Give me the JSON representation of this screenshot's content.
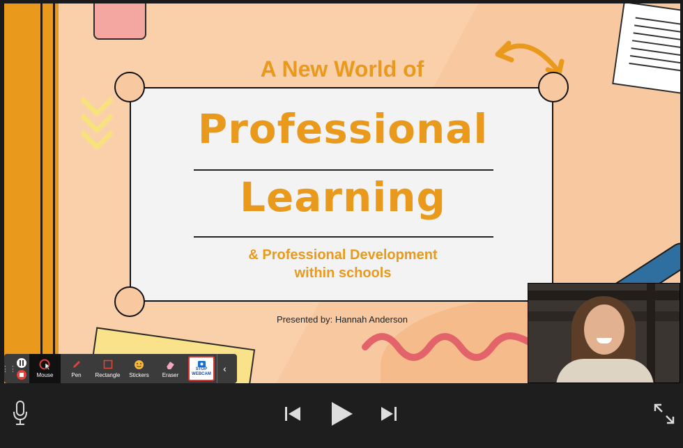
{
  "slide": {
    "kicker": "A New World of",
    "title_line1": "Professional",
    "title_line2": "Learning",
    "subtitle_line1": "& Professional Development",
    "subtitle_line2": "within schools",
    "presenter": "Presented by: Hannah Anderson"
  },
  "toolbar": {
    "tools": [
      {
        "label": "Mouse",
        "icon": "mouse-cursor-icon",
        "active": true
      },
      {
        "label": "Pen",
        "icon": "pen-icon",
        "active": false
      },
      {
        "label": "Rectangle",
        "icon": "rectangle-icon",
        "active": false
      },
      {
        "label": "Stickers",
        "icon": "sticker-icon",
        "active": false
      },
      {
        "label": "Eraser",
        "icon": "eraser-icon",
        "active": false
      }
    ],
    "stop_webcam_line1": "STOP",
    "stop_webcam_line2": "WEBCAM"
  },
  "controls": {
    "mic_icon": "microphone-icon",
    "prev_icon": "skip-previous-icon",
    "play_icon": "play-icon",
    "next_icon": "skip-next-icon",
    "expand_icon": "expand-icon"
  },
  "colors": {
    "accent_orange": "#e99a1c",
    "slide_background": "#f8c9a0",
    "toolbar_background": "#3b3b3b",
    "controls_background": "#1e1e1e",
    "record_red": "#e0443a"
  }
}
